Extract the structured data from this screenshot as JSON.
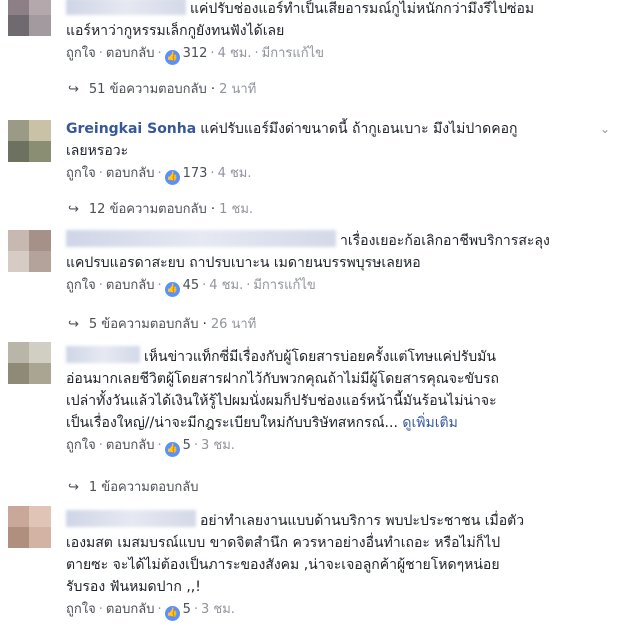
{
  "labels": {
    "like": "ถูกใจ",
    "reply": "ตอบกลับ",
    "edited": "มีการแก้ไข",
    "see_more": "ดูเพิ่มเติม",
    "like_icon": "thumbs-up-icon",
    "reply_arrow_icon": "reply-arrow-icon",
    "chevron_icon": "chevron-down-icon"
  },
  "comments": [
    {
      "name": "",
      "lines": [
        "แค่ปรับช่องแอร์ทำเป็นเสียอารมณ์กูไม่หนักกว่ามึงรีไปซ่อม",
        "แอร์หาว่ากูหรรมเล็กกูยังทนฟังได้เลย"
      ],
      "likes": "312",
      "time": "4 ชม.",
      "edited": true,
      "replies": "51 ข้อความตอบกลับ",
      "replies_time": "2 นาที"
    },
    {
      "name": "Greingkai Sonha",
      "lines": [
        "แค่ปรับแอร์มึงด่าขนาดนี้ ถ้ากูเอนเบาะ มึงไม่ปาดคอกู",
        "เลยหรอวะ"
      ],
      "likes": "173",
      "time": "4 ชม.",
      "edited": false,
      "replies": "12 ข้อความตอบกลับ",
      "replies_time": "1 ชม."
    },
    {
      "name": "",
      "lines": [
        "าเรื่องเยอะก้อเลิกอาชีพบริการสะลุง",
        "แคปรบแอรดาสะยบ ถาปรบเบาะน เมดายนบรรพบุรษเลยหอ"
      ],
      "likes": "45",
      "time": "4 ชม.",
      "edited": true,
      "replies": "5 ข้อความตอบกลับ",
      "replies_time": "26 นาที"
    },
    {
      "name": "",
      "lines": [
        "เห็นข่าวแท็กซี่มีเรื่องกับผู้โดยสารบ่อยครั้งแต่โทษแค่ปรับมัน",
        "อ่อนมากเลยชีวิตผู้โดยสารฝากไว้กับพวกคุณถ้าไม่มีผู้โดยสารคุณจะขับรถ",
        "เปล่าทั้งวันแล้วได้เงินให้รู้ไปผมนั่งผมก็ปรับช่องแอร์หน้านี้มันร้อนไม่น่าจะ",
        "เป็นเรื่องใหญ่//น่าจะมีกฎระเบียบใหม่กับบริษัทสหกรณ์..."
      ],
      "see_more": true,
      "likes": "5",
      "time": "3 ชม.",
      "edited": false,
      "replies": "1 ข้อความตอบกลับ",
      "replies_time": ""
    },
    {
      "name": "",
      "lines": [
        "อย่าทำเลยงานแบบด้านบริการ พบปะประชาชน เมื่อตัว",
        "เองมสต เมสมบรณ์แบบ ขาดจิตสำนึก ควรหาอย่างอื่นทำเถอะ หรือไม่ก็ไป",
        "ตายซะ จะได้ไม่ต้องเป็นภาระของสังคม ,น่าจะเจอลูกค้าผู้ชายโหดๆหน่อย",
        "รับรอง ฟันหมดปาก ,,!"
      ],
      "likes": "5",
      "time": "3 ชม.",
      "edited": false,
      "replies": "",
      "replies_time": ""
    }
  ],
  "colors": {
    "name": "#365899",
    "meta": "#90949c",
    "like_badge": "#5890ff"
  }
}
